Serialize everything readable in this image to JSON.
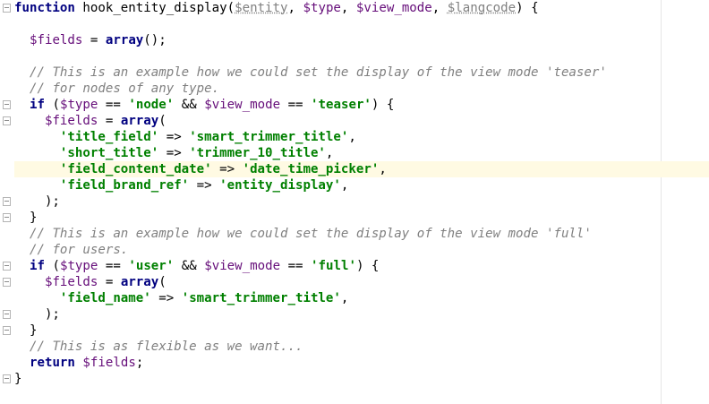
{
  "code": {
    "lines": [
      [
        {
          "t": "kw",
          "v": "function"
        },
        {
          "t": "p",
          "v": " hook_entity_display("
        },
        {
          "t": "pu",
          "v": "$entity"
        },
        {
          "t": "p",
          "v": ", "
        },
        {
          "t": "var",
          "v": "$type"
        },
        {
          "t": "p",
          "v": ", "
        },
        {
          "t": "var",
          "v": "$view_mode"
        },
        {
          "t": "p",
          "v": ", "
        },
        {
          "t": "pu",
          "v": "$langcode"
        },
        {
          "t": "p",
          "v": ") {"
        }
      ],
      [],
      [
        {
          "t": "p",
          "v": "  "
        },
        {
          "t": "var",
          "v": "$fields"
        },
        {
          "t": "p",
          "v": " = "
        },
        {
          "t": "kw",
          "v": "array"
        },
        {
          "t": "p",
          "v": "();"
        }
      ],
      [],
      [
        {
          "t": "p",
          "v": "  "
        },
        {
          "t": "cm",
          "v": "// This is an example how we could set the display of the view mode 'teaser'"
        }
      ],
      [
        {
          "t": "p",
          "v": "  "
        },
        {
          "t": "cm",
          "v": "// for nodes of any type."
        }
      ],
      [
        {
          "t": "p",
          "v": "  "
        },
        {
          "t": "kw",
          "v": "if"
        },
        {
          "t": "p",
          "v": " ("
        },
        {
          "t": "var",
          "v": "$type"
        },
        {
          "t": "p",
          "v": " == "
        },
        {
          "t": "str",
          "v": "'node'"
        },
        {
          "t": "p",
          "v": " && "
        },
        {
          "t": "var",
          "v": "$view_mode"
        },
        {
          "t": "p",
          "v": " == "
        },
        {
          "t": "str",
          "v": "'teaser'"
        },
        {
          "t": "p",
          "v": ") {"
        }
      ],
      [
        {
          "t": "p",
          "v": "    "
        },
        {
          "t": "var",
          "v": "$fields"
        },
        {
          "t": "p",
          "v": " = "
        },
        {
          "t": "kw",
          "v": "array"
        },
        {
          "t": "p",
          "v": "("
        }
      ],
      [
        {
          "t": "p",
          "v": "      "
        },
        {
          "t": "str",
          "v": "'title_field'"
        },
        {
          "t": "p",
          "v": " => "
        },
        {
          "t": "str",
          "v": "'smart_trimmer_title'"
        },
        {
          "t": "p",
          "v": ","
        }
      ],
      [
        {
          "t": "p",
          "v": "      "
        },
        {
          "t": "str",
          "v": "'short_title'"
        },
        {
          "t": "p",
          "v": " => "
        },
        {
          "t": "str",
          "v": "'trimmer_10_title'"
        },
        {
          "t": "p",
          "v": ","
        }
      ],
      [
        {
          "t": "p",
          "v": "      "
        },
        {
          "t": "str",
          "v": "'field_content_date'"
        },
        {
          "t": "p",
          "v": " => "
        },
        {
          "t": "str",
          "v": "'date_time_picker'"
        },
        {
          "t": "p",
          "v": ","
        }
      ],
      [
        {
          "t": "p",
          "v": "      "
        },
        {
          "t": "str",
          "v": "'field_brand_ref'"
        },
        {
          "t": "p",
          "v": " => "
        },
        {
          "t": "str",
          "v": "'entity_display'"
        },
        {
          "t": "p",
          "v": ","
        }
      ],
      [
        {
          "t": "p",
          "v": "    );"
        }
      ],
      [
        {
          "t": "p",
          "v": "  }"
        }
      ],
      [
        {
          "t": "p",
          "v": "  "
        },
        {
          "t": "cm",
          "v": "// This is an example how we could set the display of the view mode 'full'"
        }
      ],
      [
        {
          "t": "p",
          "v": "  "
        },
        {
          "t": "cm",
          "v": "// for users."
        }
      ],
      [
        {
          "t": "p",
          "v": "  "
        },
        {
          "t": "kw",
          "v": "if"
        },
        {
          "t": "p",
          "v": " ("
        },
        {
          "t": "var",
          "v": "$type"
        },
        {
          "t": "p",
          "v": " == "
        },
        {
          "t": "str",
          "v": "'user'"
        },
        {
          "t": "p",
          "v": " && "
        },
        {
          "t": "var",
          "v": "$view_mode"
        },
        {
          "t": "p",
          "v": " == "
        },
        {
          "t": "str",
          "v": "'full'"
        },
        {
          "t": "p",
          "v": ") {"
        }
      ],
      [
        {
          "t": "p",
          "v": "    "
        },
        {
          "t": "var",
          "v": "$fields"
        },
        {
          "t": "p",
          "v": " = "
        },
        {
          "t": "kw",
          "v": "array"
        },
        {
          "t": "p",
          "v": "("
        }
      ],
      [
        {
          "t": "p",
          "v": "      "
        },
        {
          "t": "str",
          "v": "'field_name'"
        },
        {
          "t": "p",
          "v": " => "
        },
        {
          "t": "str",
          "v": "'smart_trimmer_title'"
        },
        {
          "t": "p",
          "v": ","
        }
      ],
      [
        {
          "t": "p",
          "v": "    );"
        }
      ],
      [
        {
          "t": "p",
          "v": "  }"
        }
      ],
      [
        {
          "t": "p",
          "v": "  "
        },
        {
          "t": "cm",
          "v": "// This is as flexible as we want..."
        }
      ],
      [
        {
          "t": "p",
          "v": "  "
        },
        {
          "t": "kw",
          "v": "return"
        },
        {
          "t": "p",
          "v": " "
        },
        {
          "t": "var",
          "v": "$fields"
        },
        {
          "t": "p",
          "v": ";"
        }
      ],
      [
        {
          "t": "p",
          "v": "}"
        }
      ]
    ],
    "current_line": 10
  },
  "colors": {
    "keyword": "#000080",
    "variable": "#660e7a",
    "string": "#008000",
    "comment": "#808080",
    "current_line_bg": "#fffae3"
  }
}
